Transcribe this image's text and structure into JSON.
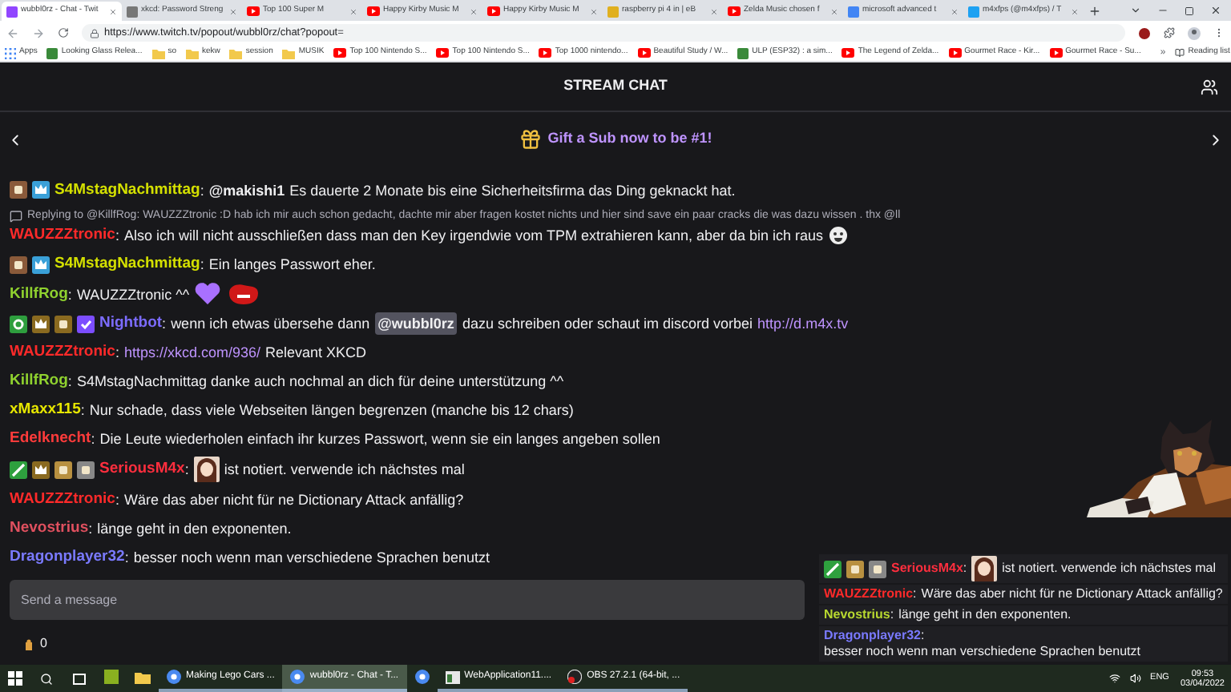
{
  "browser": {
    "tabs": [
      {
        "title": "wubbl0rz - Chat - Twit",
        "kind": "twitch",
        "selected": true
      },
      {
        "title": "xkcd: Password Streng",
        "kind": "xkcd",
        "selected": false
      },
      {
        "title": "Top 100 Super M",
        "kind": "youtube",
        "selected": false
      },
      {
        "title": "Happy Kirby Music M",
        "kind": "youtube",
        "selected": false
      },
      {
        "title": "Happy Kirby Music M",
        "kind": "youtube",
        "selected": false
      },
      {
        "title": "raspberry pi 4 in | eB",
        "kind": "shop",
        "selected": false
      },
      {
        "title": "Zelda Music chosen f",
        "kind": "youtube",
        "selected": false
      },
      {
        "title": "microsoft advanced t",
        "kind": "google",
        "selected": false
      },
      {
        "title": "m4xfps (@m4xfps) / T",
        "kind": "twitter",
        "selected": false
      }
    ],
    "url": "https://www.twitch.tv/popout/wubbl0rz/chat?popout=",
    "bookmarks": [
      {
        "label": "Apps",
        "kind": "apps"
      },
      {
        "label": "Looking Glass Relea...",
        "kind": "page"
      },
      {
        "label": "so",
        "kind": "folder"
      },
      {
        "label": "kekw",
        "kind": "folder"
      },
      {
        "label": "session",
        "kind": "folder"
      },
      {
        "label": "MUSIK",
        "kind": "folder"
      },
      {
        "label": "Top 100 Nintendo S...",
        "kind": "youtube"
      },
      {
        "label": "Top 100 Nintendo S...",
        "kind": "youtube"
      },
      {
        "label": "Top 1000 nintendo...",
        "kind": "youtube"
      },
      {
        "label": "Beautiful Study / W...",
        "kind": "youtube"
      },
      {
        "label": "ULP (ESP32) : a sim...",
        "kind": "page"
      },
      {
        "label": "The Legend of Zelda...",
        "kind": "youtube"
      },
      {
        "label": "Gourmet Race - Kir...",
        "kind": "youtube"
      },
      {
        "label": "Gourmet Race - Su...",
        "kind": "youtube"
      }
    ],
    "more": "»",
    "reading_list": "Reading list"
  },
  "chat": {
    "title": "STREAM CHAT",
    "banner": "Gift a Sub now to be #1!",
    "reply": "Replying to @KillfRog: WAUZZZtronic :D hab ich mir auch schon gedacht, dachte mir aber fragen kostet nichts und hier sind save ein paar cracks die was dazu wissen . thx @ll",
    "messages": [
      {
        "user": "S4MstagNachmittag",
        "sep": ":",
        "color": "#d4e000",
        "badges": [
          {
            "kind": "bits"
          },
          {
            "kind": "sub"
          }
        ],
        "parts": [
          {
            "kind": "mention",
            "text": "@makishi1"
          },
          {
            "kind": "text",
            "text": "Es dauerte 2 Monate bis eine Sicherheitsfirma das Ding geknackt hat."
          }
        ]
      },
      {
        "user": "WAUZZZtronic",
        "sep": ":",
        "color": "#ff2a2a",
        "reply": true,
        "parts": [
          {
            "kind": "text",
            "text": "Also ich will nicht ausschließen dass man den Key irgendwie vom TPM extrahieren kann, aber da bin ich raus"
          },
          {
            "kind": "smiley"
          }
        ]
      },
      {
        "user": "S4MstagNachmittag",
        "sep": ":",
        "color": "#d4e000",
        "badges": [
          {
            "kind": "bits"
          },
          {
            "kind": "sub"
          }
        ],
        "parts": [
          {
            "kind": "text",
            "text": "Ein langes Passwort eher."
          }
        ]
      },
      {
        "user": "KillfRog",
        "sep": ":",
        "color": "#8fd12f",
        "parts": [
          {
            "kind": "text",
            "text": "WAUZZZtronic ^^"
          },
          {
            "kind": "heart"
          },
          {
            "kind": "blob"
          }
        ]
      },
      {
        "user": "Nightbot",
        "sep": ":",
        "color": "#7c6cff",
        "badges": [
          {
            "kind": "gear"
          },
          {
            "kind": "crown"
          },
          {
            "kind": "boot"
          },
          {
            "kind": "verified"
          }
        ],
        "parts": [
          {
            "kind": "text",
            "text": "wenn ich etwas übersehe dann"
          },
          {
            "kind": "pill",
            "text": "@wubbl0rz"
          },
          {
            "kind": "text",
            "text": "dazu schreiben oder schaut im discord vorbei"
          },
          {
            "kind": "link",
            "text": "http://d.m4x.tv"
          }
        ]
      },
      {
        "user": "WAUZZZtronic",
        "sep": ":",
        "color": "#ff2a2a",
        "parts": [
          {
            "kind": "link",
            "text": "https://xkcd.com/936/"
          },
          {
            "kind": "text",
            "text": "Relevant XKCD"
          }
        ]
      },
      {
        "user": "KillfRog",
        "sep": ":",
        "color": "#8fd12f",
        "parts": [
          {
            "kind": "text",
            "text": "S4MstagNachmittag danke auch nochmal an dich für deine unterstützung ^^"
          }
        ]
      },
      {
        "user": "xMaxx115",
        "sep": ":",
        "color": "#e6e600",
        "parts": [
          {
            "kind": "text",
            "text": "Nur schade, dass viele Webseiten längen begrenzen (manche bis 12 chars)"
          }
        ]
      },
      {
        "user": "Edelknecht",
        "sep": ":",
        "color": "#ff3b3b",
        "parts": [
          {
            "kind": "text",
            "text": "Die Leute wiederholen einfach ihr kurzes Passwort, wenn sie ein langes angeben sollen"
          }
        ]
      },
      {
        "user": "SeriousM4x",
        "sep": ":",
        "color": "#ff2e3e",
        "badges": [
          {
            "kind": "sword"
          },
          {
            "kind": "crown"
          },
          {
            "kind": "box"
          },
          {
            "kind": "globe"
          }
        ],
        "parts": [
          {
            "kind": "figure"
          },
          {
            "kind": "text",
            "text": "ist notiert. verwende ich nächstes mal"
          }
        ]
      },
      {
        "user": "WAUZZZtronic",
        "sep": ":",
        "color": "#ff2a2a",
        "parts": [
          {
            "kind": "text",
            "text": "Wäre das aber nicht für ne Dictionary Attack anfällig?"
          }
        ]
      },
      {
        "user": "Nevostrius",
        "sep": ":",
        "color": "#e0505f",
        "parts": [
          {
            "kind": "text",
            "text": "länge geht in den exponenten."
          }
        ]
      },
      {
        "user": "Dragonplayer32",
        "sep": ":",
        "color": "#7a7aff",
        "parts": [
          {
            "kind": "text",
            "text": "besser noch wenn man verschiedene Sprachen benutzt"
          }
        ]
      }
    ],
    "input": {
      "placeholder": "Send a message"
    },
    "points": "0"
  },
  "overlay": {
    "kind": "picture",
    "messages": [
      {
        "user": "SeriousM4x",
        "sep": ":",
        "color": "#ff2e3e",
        "badges": [
          {
            "kind": "sword"
          },
          {
            "kind": "box"
          },
          {
            "kind": "globe"
          }
        ],
        "parts": [
          {
            "kind": "figure"
          },
          {
            "kind": "text",
            "text": "ist notiert. verwende ich nächstes mal"
          }
        ]
      },
      {
        "user": "WAUZZZtronic",
        "sep": ":",
        "color": "#ff2a2a",
        "parts": [
          {
            "kind": "text",
            "text": "Wäre das aber nicht für ne Dictionary Attack anfällig?"
          }
        ]
      },
      {
        "user": "Nevostrius",
        "sep": ":",
        "color": "#b8d830",
        "parts": [
          {
            "kind": "text",
            "text": "länge geht in den exponenten."
          }
        ]
      },
      {
        "user": "Dragonplayer32",
        "sep": ":",
        "color": "#7a7aff",
        "parts": [
          {
            "kind": "text",
            "text": "besser noch wenn man verschiedene Sprachen benutzt"
          }
        ]
      }
    ]
  },
  "taskbar": {
    "items": [
      {
        "kind": "lambda",
        "selected": false
      },
      {
        "kind": "files",
        "selected": false
      },
      {
        "kind": "chrome",
        "label": "Making Lego Cars ...",
        "selected": false
      },
      {
        "kind": "chrome",
        "label": "wubbl0rz - Chat - T...",
        "selected": true
      },
      {
        "kind": "chrome",
        "selected": false
      },
      {
        "kind": "app",
        "label": "WebApplication11....",
        "selected": false
      },
      {
        "kind": "obs",
        "label": "OBS 27.2.1 (64-bit, ...",
        "selected": false
      }
    ],
    "language": "ENG",
    "time": "09:53",
    "date": "03/04/2022"
  }
}
